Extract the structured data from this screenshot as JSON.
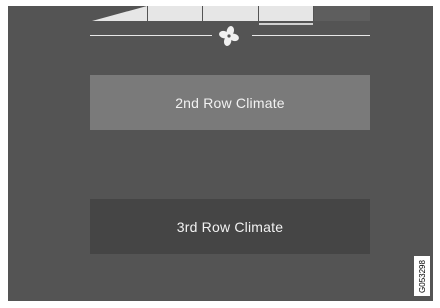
{
  "fan_speed": {
    "level": 3,
    "max_level": 4
  },
  "buttons": {
    "second_row": "2nd Row Climate",
    "third_row": "3rd Row Climate"
  },
  "figure_code": "G053298",
  "icons": {
    "fan": "fan-icon"
  },
  "colors": {
    "background": "#545454",
    "button_active": "#7a7a7a",
    "button_inactive": "#454545",
    "segment_on": "#e6e6e6"
  }
}
